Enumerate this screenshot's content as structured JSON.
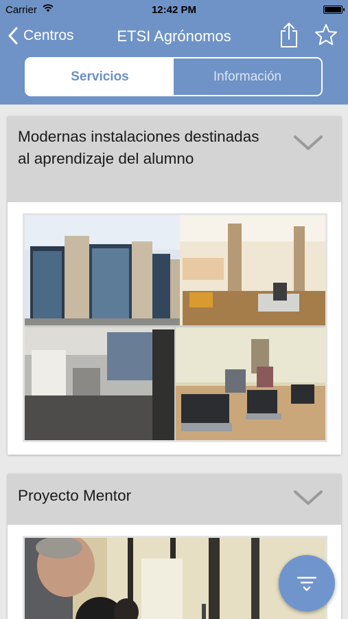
{
  "status_bar": {
    "carrier": "Carrier",
    "time": "12:42 PM"
  },
  "nav": {
    "back_label": "Centros",
    "title": "ETSI Agrónomos"
  },
  "tabs": [
    {
      "label": "Servicios",
      "active": true
    },
    {
      "label": "Información",
      "active": false
    }
  ],
  "cards": [
    {
      "title": "Modernas instalaciones destinadas al aprendizaje del alumno",
      "image": "photo-collage-facilities"
    },
    {
      "title": "Proyecto Mentor",
      "image": "photo-mentoring-session"
    }
  ],
  "icons": {
    "back": "chevron-left-icon",
    "share": "share-icon",
    "favorite": "star-icon",
    "expand": "chevron-down-icon",
    "filter": "filter-icon",
    "wifi": "wifi-icon",
    "battery": "battery-icon"
  },
  "colors": {
    "header": "#6f93c6",
    "active_tab_text": "#6a8fc2",
    "card_header": "#d4d4d4",
    "background": "#e9e9e9",
    "fab": "#7095cd"
  }
}
